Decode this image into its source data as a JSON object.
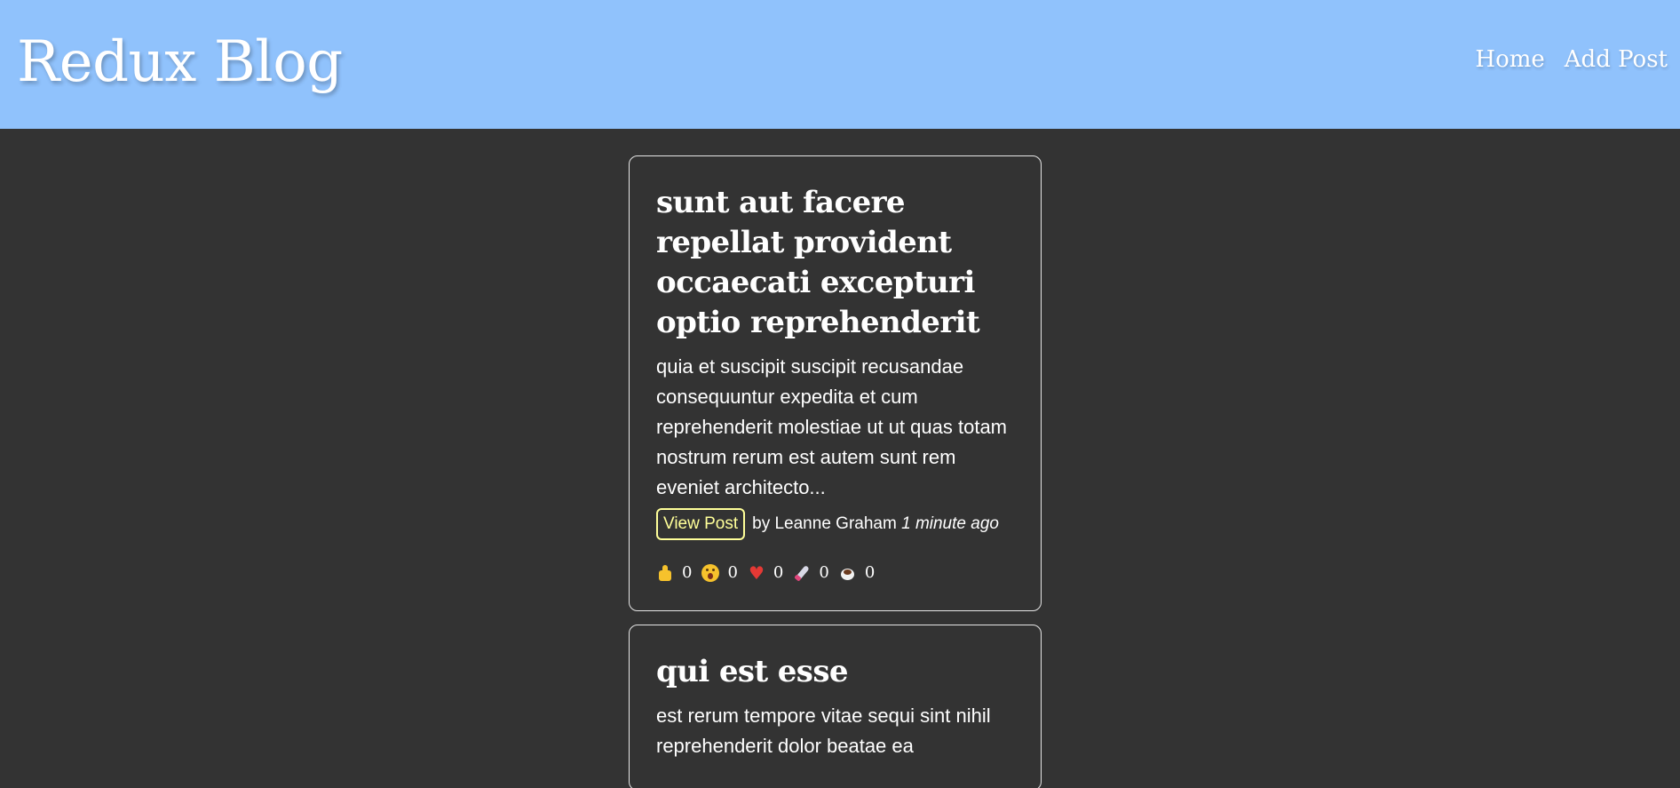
{
  "header": {
    "title": "Redux Blog",
    "nav": [
      {
        "label": "Home"
      },
      {
        "label": "Add Post"
      }
    ]
  },
  "posts": [
    {
      "title": "sunt aut facere repellat provident occaecati excepturi optio reprehenderit",
      "body": "quia et suscipit suscipit recusandae consequuntur expedita et cum reprehenderit molestiae ut ut quas totam nostrum rerum est autem sunt rem eveniet architecto...",
      "view_label": "View Post",
      "author": "by Leanne Graham",
      "time": "1 minute ago",
      "reactions": [
        {
          "icon": "thumbs-up-icon",
          "count": "0"
        },
        {
          "icon": "wow-icon",
          "count": "0"
        },
        {
          "icon": "heart-icon",
          "count": "0"
        },
        {
          "icon": "rocket-icon",
          "count": "0"
        },
        {
          "icon": "coffee-icon",
          "count": "0"
        }
      ]
    },
    {
      "title": "qui est esse",
      "body": "est rerum tempore vitae sequi sint nihil reprehenderit dolor beatae ea"
    }
  ],
  "colors": {
    "header_bg": "#90c2fc",
    "page_bg": "#333333",
    "button_accent": "#ffff99"
  }
}
